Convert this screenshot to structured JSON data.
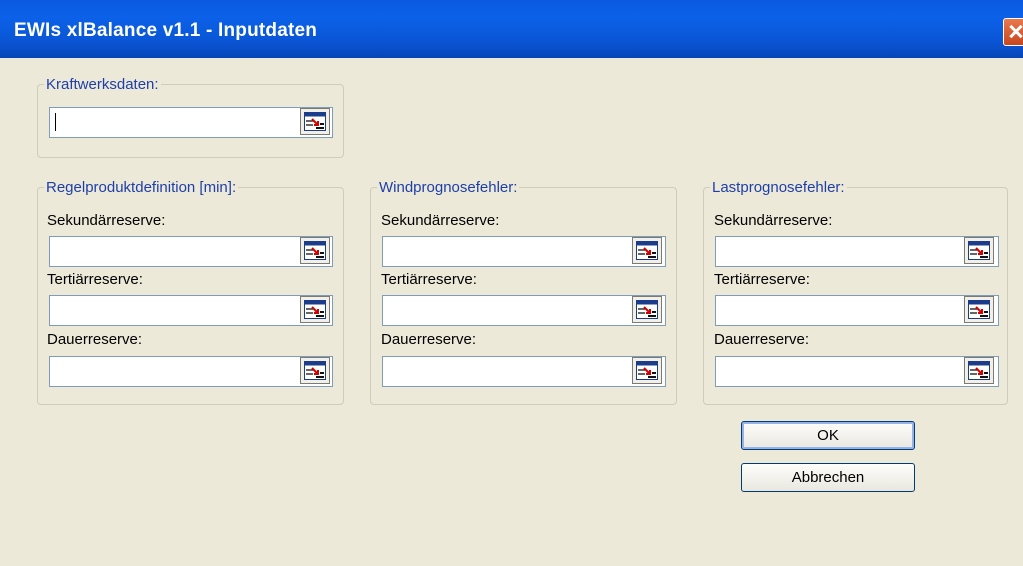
{
  "window": {
    "title": "EWIs xlBalance v1.1 - Inputdaten"
  },
  "groups": {
    "kraftwerk": {
      "legend": "Kraftwerksdaten:"
    },
    "regel": {
      "legend": "Regelproduktdefinition [min]:",
      "labels": [
        "Sekundärreserve:",
        "Tertiärreserve:",
        "Dauerreserve:"
      ]
    },
    "wind": {
      "legend": "Windprognosefehler:",
      "labels": [
        "Sekundärreserve:",
        "Tertiärreserve:",
        "Dauerreserve:"
      ]
    },
    "last": {
      "legend": "Lastprognosefehler:",
      "labels": [
        "Sekundärreserve:",
        "Tertiärreserve:",
        "Dauerreserve:"
      ]
    }
  },
  "buttons": {
    "ok": "OK",
    "cancel": "Abbrechen"
  },
  "icons": {
    "close": "close-icon",
    "range_select": "range-select-icon"
  }
}
